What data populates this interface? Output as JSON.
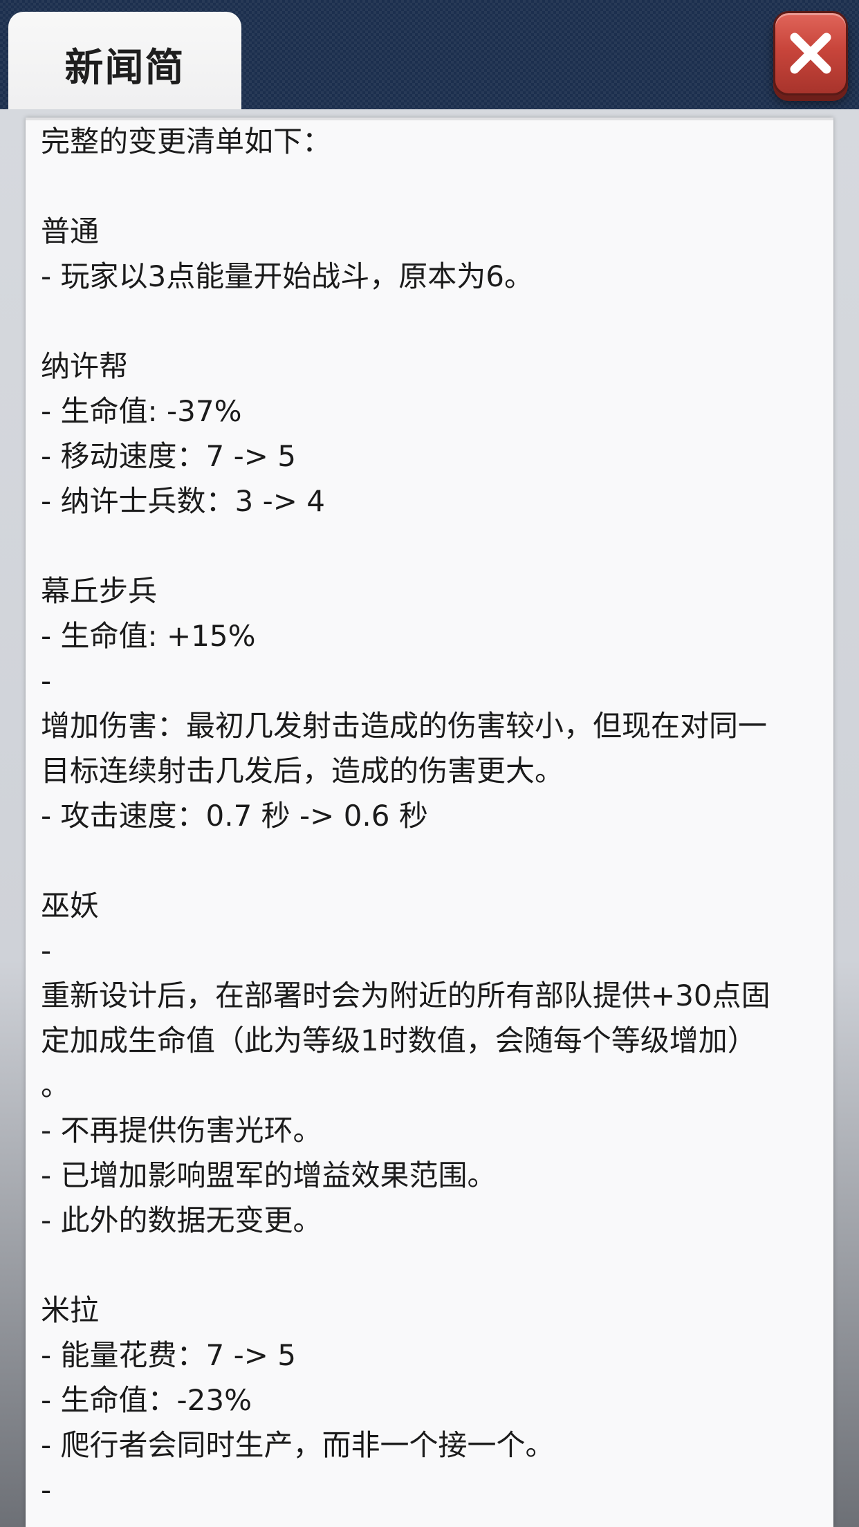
{
  "header": {
    "tab_title": "新闻简",
    "close_label": "✕"
  },
  "content_lines": [
    "完整的变更清单如下：",
    "",
    "普通",
    "- 玩家以3点能量开始战斗，原本为6。",
    "",
    "纳许帮",
    "- 生命值: -37%",
    "- 移动速度：7 -> 5",
    "- 纳许士兵数：3 -> 4",
    "",
    "幕丘步兵",
    "- 生命值: +15%",
    "-",
    "增加伤害：最初几发射击造成的伤害较小，但现在对同一",
    "目标连续射击几发后，造成的伤害更大。",
    "-  攻击速度：0.7 秒 -> 0.6 秒",
    "",
    "巫妖",
    "-",
    "重新设计后，在部署时会为附近的所有部队提供+30点固",
    "定加成生命值（此为等级1时数值，会随每个等级增加）",
    "。",
    "- 不再提供伤害光环。",
    "- 已增加影响盟军的增益效果范围。",
    "- 此外的数据无变更。",
    "",
    "米拉",
    "- 能量花费：7 -> 5",
    "- 生命值：-23%",
    "- 爬行者会同时生产，而非一个接一个。",
    "-"
  ],
  "colors": {
    "header_bg": "#1c2f4e",
    "close_button": "#c8453b",
    "panel_bg": "#f9f9fa",
    "text": "#1b1b1b"
  }
}
